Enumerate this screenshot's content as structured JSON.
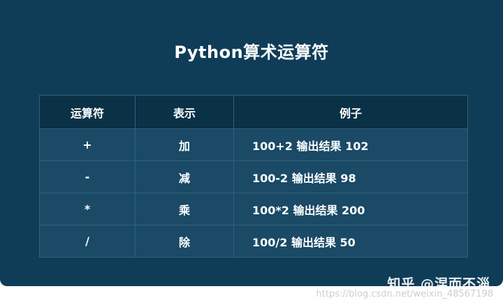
{
  "title": "Python算术运算符",
  "table": {
    "headers": [
      "运算符",
      "表示",
      "例子"
    ],
    "rows": [
      {
        "op": "+",
        "desc": "加",
        "example": "100+2 输出结果 102"
      },
      {
        "op": "-",
        "desc": "减",
        "example": "100-2 输出结果 98"
      },
      {
        "op": "*",
        "desc": "乘",
        "example": "100*2 输出结果 200"
      },
      {
        "op": "/",
        "desc": "除",
        "example": "100/2 输出结果 50"
      }
    ]
  },
  "watermarks": {
    "zhihu": "知乎 @涅而不淄",
    "csdn": "https://blog.csdn.net/weixin_48567198"
  }
}
